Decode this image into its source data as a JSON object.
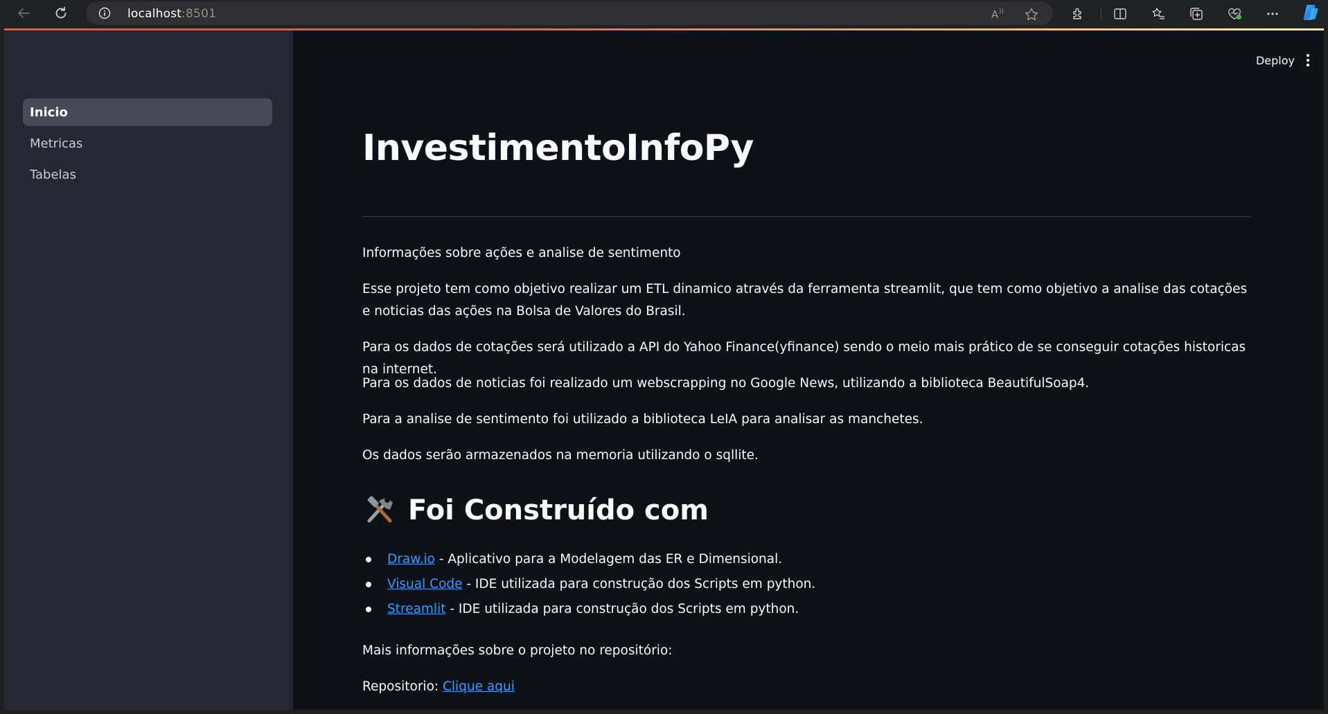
{
  "browser": {
    "url_host": "localhost",
    "url_port": ":8501",
    "read_aloud_label": "Aͅ"
  },
  "sidebar": {
    "items": [
      {
        "label": "Inicio",
        "active": true
      },
      {
        "label": "Metricas",
        "active": false
      },
      {
        "label": "Tabelas",
        "active": false
      }
    ]
  },
  "header": {
    "deploy_label": "Deploy"
  },
  "main": {
    "title": "InvestimentoInfoPy",
    "subtitle": "Informações sobre ações e analise de sentimento",
    "paragraphs": [
      "Esse projeto tem como objetivo realizar um ETL dinamico através da ferramenta streamlit, que tem como objetivo a analise das cotações e noticias das ações na Bolsa de Valores do Brasil.",
      "Para os dados de cotações será utilizado a API do Yahoo Finance(yfinance) sendo o meio mais prático de se conseguir cotações historicas na internet.",
      "Para os dados de noticias foi realizado um webscrapping no Google News, utilizando a biblioteca BeautifulSoap4.",
      "Para a analise de sentimento foi utilizado a biblioteca LeIA para analisar as manchetes.",
      "Os dados serão armazenados na memoria utilizando o sqllite."
    ],
    "built_with_title": "Foi Construído com",
    "built_with_icon": "hammer-and-wrench-icon",
    "tools": [
      {
        "link": "Draw.io",
        "desc": " - Aplicativo para a Modelagem das ER e Dimensional."
      },
      {
        "link": "Visual Code",
        "desc": " - IDE utilizada para construção dos Scripts em python."
      },
      {
        "link": "Streamlit",
        "desc": " - IDE utilizada para construção dos Scripts em python."
      }
    ],
    "more_info": "Mais informações sobre o projeto no repositório:",
    "repo_label": "Repositorio: ",
    "repo_link": "Clique aqui"
  },
  "colors": {
    "main_bg": "#0e1117",
    "sidebar_bg": "#262730",
    "link": "#3c9bff",
    "accent": "#ff4b4b"
  }
}
